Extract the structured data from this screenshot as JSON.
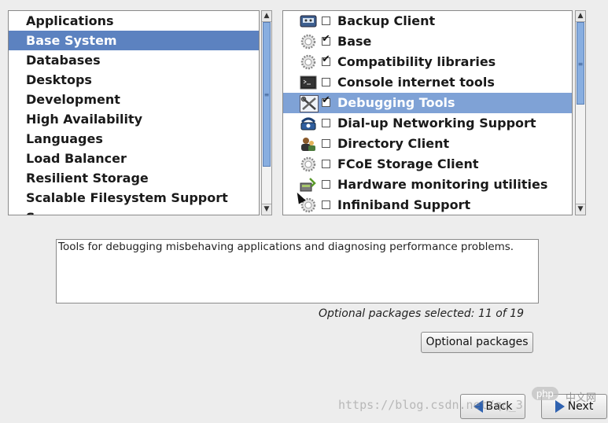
{
  "groups": [
    {
      "label": "Applications",
      "selected": false
    },
    {
      "label": "Base System",
      "selected": true
    },
    {
      "label": "Databases",
      "selected": false
    },
    {
      "label": "Desktops",
      "selected": false
    },
    {
      "label": "Development",
      "selected": false
    },
    {
      "label": "High Availability",
      "selected": false
    },
    {
      "label": "Languages",
      "selected": false
    },
    {
      "label": "Load Balancer",
      "selected": false
    },
    {
      "label": "Resilient Storage",
      "selected": false
    },
    {
      "label": "Scalable Filesystem Support",
      "selected": false
    }
  ],
  "packages": [
    {
      "label": "Backup Client",
      "checked": false,
      "selected": false,
      "icon": "backup-icon"
    },
    {
      "label": "Base",
      "checked": true,
      "selected": false,
      "icon": "gear-icon"
    },
    {
      "label": "Compatibility libraries",
      "checked": true,
      "selected": false,
      "icon": "gear-icon"
    },
    {
      "label": "Console internet tools",
      "checked": false,
      "selected": false,
      "icon": "terminal-icon"
    },
    {
      "label": "Debugging Tools",
      "checked": true,
      "selected": true,
      "icon": "tools-icon"
    },
    {
      "label": "Dial-up Networking Support",
      "checked": false,
      "selected": false,
      "icon": "phone-icon"
    },
    {
      "label": "Directory Client",
      "checked": false,
      "selected": false,
      "icon": "users-icon"
    },
    {
      "label": "FCoE Storage Client",
      "checked": false,
      "selected": false,
      "icon": "gear-icon"
    },
    {
      "label": "Hardware monitoring utilities",
      "checked": false,
      "selected": false,
      "icon": "hardware-icon"
    },
    {
      "label": "Infiniband Support",
      "checked": false,
      "selected": false,
      "icon": "gear-icon"
    }
  ],
  "description": "Tools for debugging misbehaving applications and diagnosing performance problems.",
  "optional_status": "Optional packages selected: 11 of 19",
  "buttons": {
    "optional_packages": "Optional packages",
    "back": "Back",
    "next": "Next"
  },
  "watermark": "https://blog.csdn.net/qq_3",
  "php_logo": "php",
  "php_cn": "中文网",
  "colors": {
    "group_selected": "#5c82c0",
    "package_selected": "#7fa2d6",
    "arrow": "#2f62b0"
  }
}
